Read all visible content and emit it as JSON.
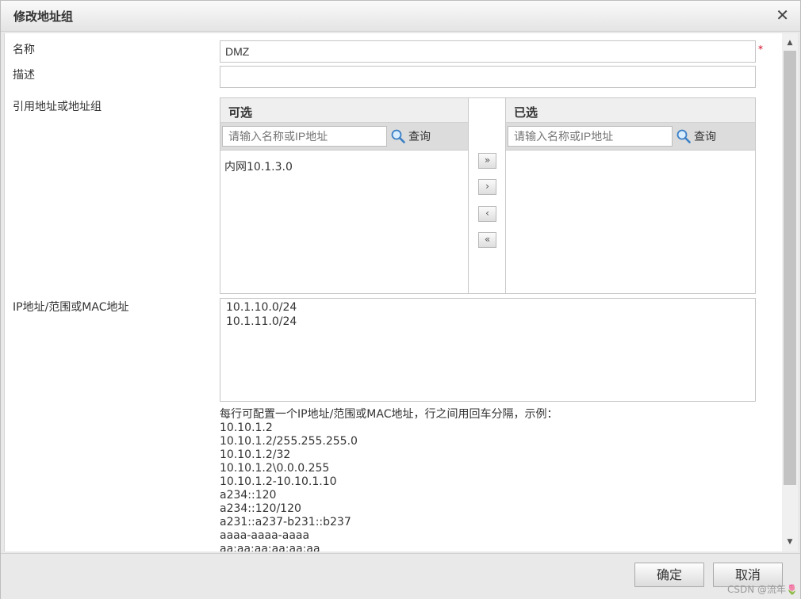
{
  "dialog": {
    "title": "修改地址组",
    "close_symbol": "✕"
  },
  "form": {
    "name_label": "名称",
    "name_value": "DMZ",
    "required_mark": "*",
    "desc_label": "描述",
    "desc_value": "",
    "ref_label": "引用地址或地址组",
    "ip_label": "IP地址/范围或MAC地址"
  },
  "picker": {
    "available": {
      "title": "可选",
      "search_placeholder": "请输入名称或IP地址",
      "search_label": "查询",
      "items": [
        "内网10.1.3.0"
      ]
    },
    "selected": {
      "title": "已选",
      "search_placeholder": "请输入名称或IP地址",
      "search_label": "查询",
      "items": []
    },
    "buttons": {
      "add_all": "»",
      "add": "›",
      "remove": "‹",
      "remove_all": "«"
    }
  },
  "ip_entries": "10.1.10.0/24\n10.1.11.0/24",
  "help": {
    "intro": "每行可配置一个IP地址/范围或MAC地址，行之间用回车分隔，示例：",
    "examples": [
      "10.10.1.2",
      "10.10.1.2/255.255.255.0",
      "10.10.1.2/32",
      "10.10.1.2\\0.0.0.255",
      "10.10.1.2-10.10.1.10",
      "a234::120",
      "a234::120/120",
      "a231::a237-b231::b237",
      "aaaa-aaaa-aaaa",
      "aa:aa:aa:aa:aa:aa"
    ]
  },
  "footer": {
    "confirm_label": "确定",
    "cancel_label": "取消",
    "watermark": "CSDN @流年🌷"
  },
  "icons": {
    "search": "search-icon",
    "close": "close-icon",
    "scroll_up": "scroll-up-icon",
    "scroll_down": "scroll-down-icon"
  }
}
